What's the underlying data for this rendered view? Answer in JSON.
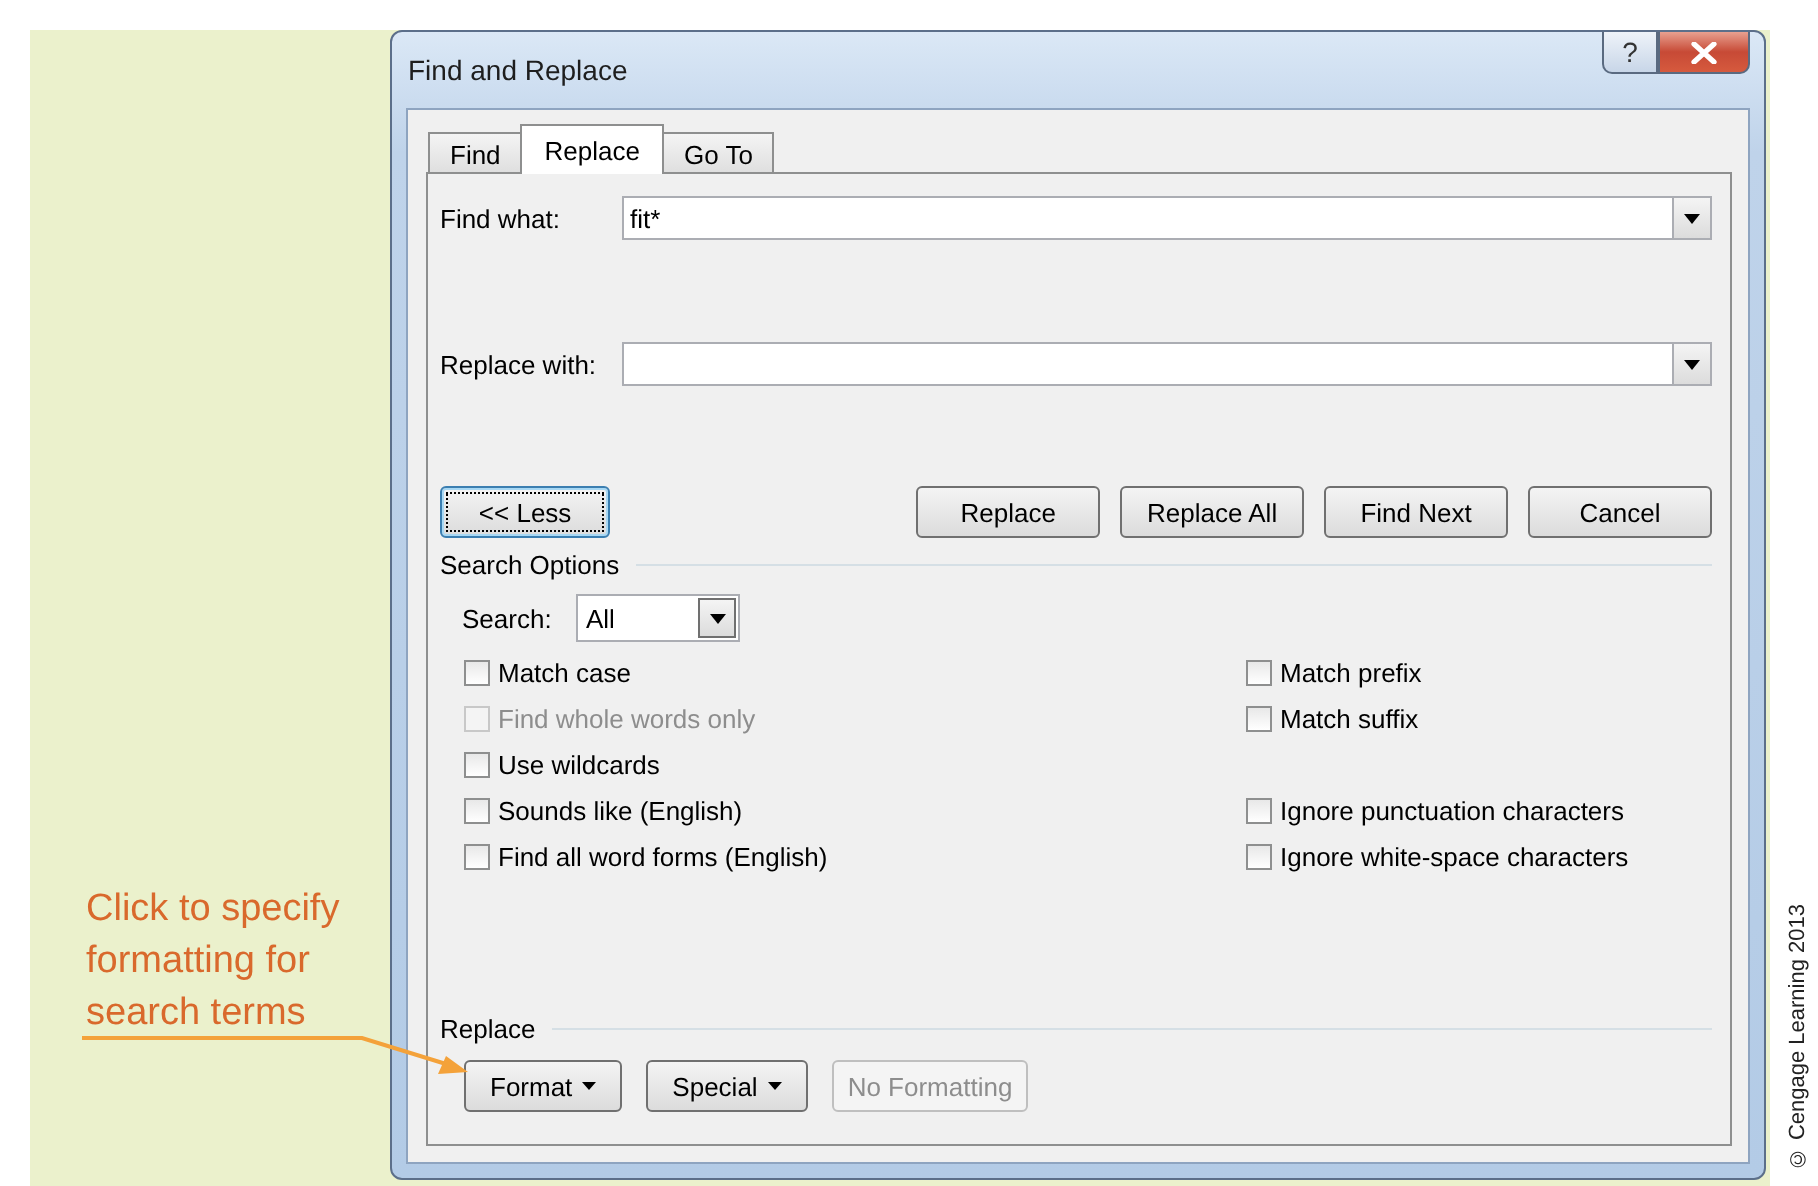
{
  "callout": {
    "text": "Click to specify formatting for search terms"
  },
  "dialog": {
    "title": "Find and Replace",
    "help_button": "?",
    "tabs": [
      {
        "label": "Find",
        "selected": false
      },
      {
        "label": "Replace",
        "selected": true
      },
      {
        "label": "Go To",
        "selected": false
      }
    ],
    "find_what": {
      "label": "Find what:",
      "value": "fit*"
    },
    "replace_with": {
      "label": "Replace with:"
    },
    "buttons": [
      {
        "label": "<< Less",
        "focused": true
      },
      {
        "label": "Replace",
        "focused": false
      },
      {
        "label": "Replace All",
        "focused": false
      },
      {
        "label": "Find Next",
        "focused": false
      },
      {
        "label": "Cancel",
        "focused": false
      }
    ],
    "search_options": {
      "heading": "Search Options",
      "search_label": "Search:",
      "search_value": "All",
      "left_options": [
        {
          "label": "Match case",
          "checked": false,
          "disabled": false
        },
        {
          "label": "Find whole words only",
          "checked": false,
          "disabled": true
        },
        {
          "label": "Use wildcards",
          "checked": false,
          "disabled": false
        },
        {
          "label": "Sounds like (English)",
          "checked": false,
          "disabled": false
        },
        {
          "label": "Find all word forms (English)",
          "checked": false,
          "disabled": false
        }
      ],
      "right_option_groups": [
        [
          {
            "label": "Match prefix",
            "checked": false,
            "disabled": false
          },
          {
            "label": "Match suffix",
            "checked": false,
            "disabled": false
          }
        ],
        [
          {
            "label": "Ignore punctuation characters",
            "checked": false,
            "disabled": false
          },
          {
            "label": "Ignore white-space characters",
            "checked": false,
            "disabled": false
          }
        ]
      ]
    },
    "replace_section": {
      "heading": "Replace",
      "buttons": [
        {
          "label": "Format",
          "dropdown": true,
          "disabled": false
        },
        {
          "label": "Special",
          "dropdown": true,
          "disabled": false
        },
        {
          "label": "No Formatting",
          "dropdown": false,
          "disabled": true
        }
      ]
    }
  },
  "credit": "© Cengage Learning 2013"
}
